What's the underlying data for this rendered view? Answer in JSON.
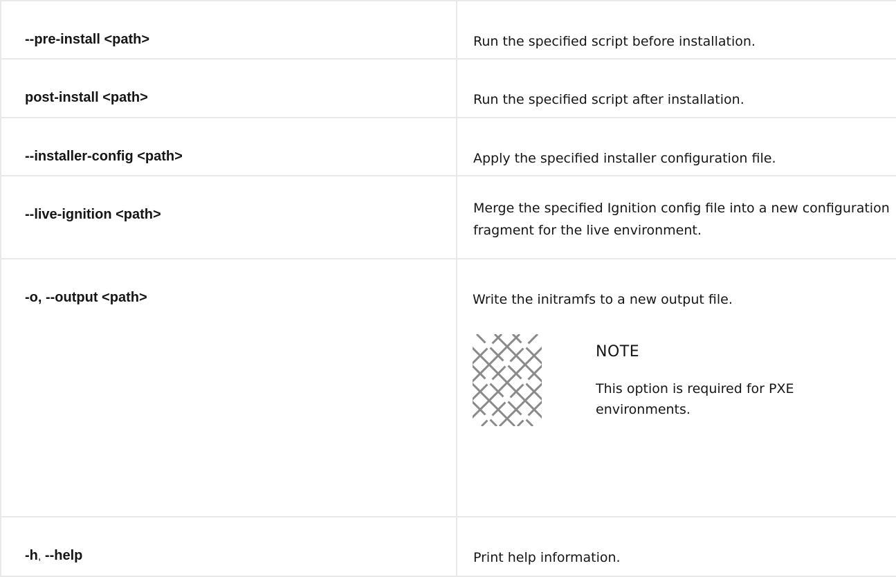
{
  "options": [
    {
      "option": "--pre-install <path>",
      "description": "Run the specified script before installation."
    },
    {
      "option": "post-install <path>",
      "description": "Run the specified script after installation."
    },
    {
      "option": "--installer-config <path>",
      "description": "Apply the specified installer configuration file."
    },
    {
      "option": "--live-ignition <path>",
      "description": "Merge the specified Ignition config file into a new configuration fragment for the live environment."
    },
    {
      "option": "-o, --output <path>",
      "description": "Write the initramfs to a new output file.",
      "note": {
        "title": "NOTE",
        "body": "This option is required for PXE environments."
      }
    },
    {
      "option_short": "-h",
      "option_sep": ",",
      "option_long": "--help",
      "description": "Print help information."
    }
  ],
  "note_icon": "note-pattern-icon"
}
